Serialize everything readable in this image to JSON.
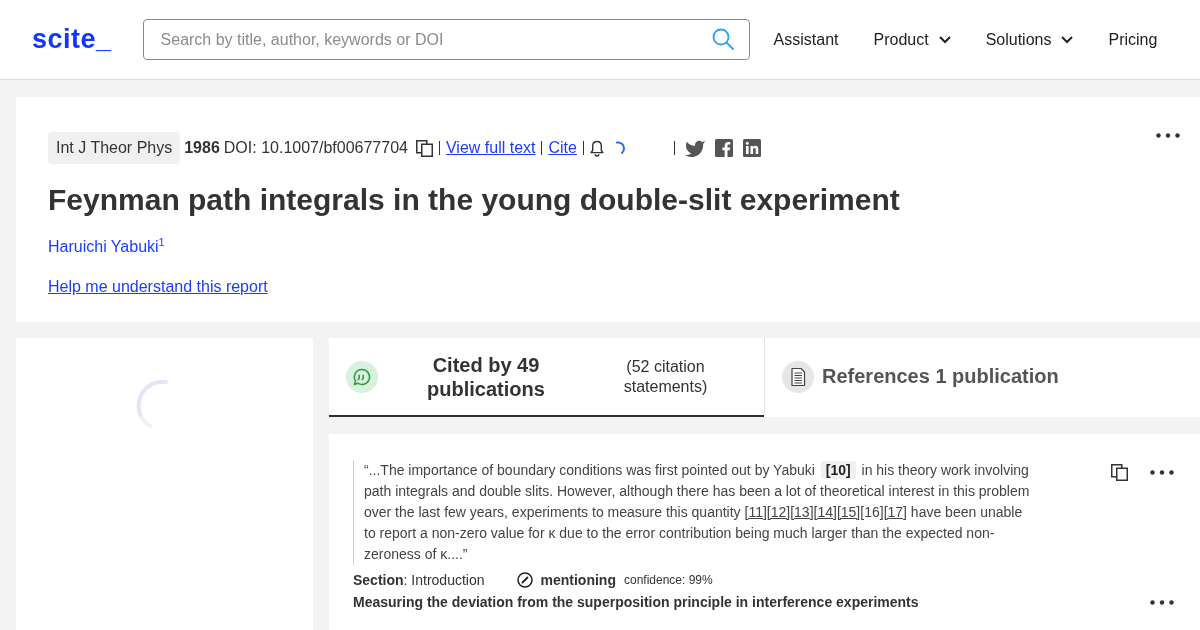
{
  "header": {
    "logo": "scite_",
    "search": {
      "placeholder": "Search by title, author, keywords or DOI"
    },
    "nav": [
      {
        "label": "Assistant",
        "dropdown": false
      },
      {
        "label": "Product",
        "dropdown": true
      },
      {
        "label": "Solutions",
        "dropdown": true
      },
      {
        "label": "Pricing",
        "dropdown": false
      }
    ]
  },
  "paper": {
    "journal": "Int J Theor Phys",
    "year": "1986",
    "doi": "DOI: 10.1007/bf00677704",
    "links": [
      "View full text",
      "Cite"
    ],
    "title": "Feynman path integrals in the young double-slit experiment",
    "authors": [
      {
        "name": "Haruichi Yabuki",
        "affiliation": "1"
      }
    ],
    "help_link": "Help me understand this report"
  },
  "tabs": [
    {
      "kind": "cited",
      "title": "Cited by 49 publications",
      "note": "(52 citation statements)",
      "selected": true
    },
    {
      "kind": "references",
      "title": "References 1 publication",
      "selected": false
    }
  ],
  "citation": {
    "quote": [
      {
        "kind": "text",
        "text": "“...The importance of boundary conditions was first pointed out by Yabuki "
      },
      {
        "kind": "marker",
        "text": "[10]"
      },
      {
        "kind": "text",
        "text": " in his theory work involving path integrals and double slits. However, although there has been a lot of theoretical interest in this problem over the last few years, experiments to measure this quantity "
      },
      {
        "kind": "link",
        "text": "[11]"
      },
      {
        "kind": "link",
        "text": "[12]"
      },
      {
        "kind": "link",
        "text": "[13]"
      },
      {
        "kind": "link",
        "text": "[14]"
      },
      {
        "kind": "link",
        "text": "[15]"
      },
      {
        "kind": "text",
        "text": "[16]"
      },
      {
        "kind": "link",
        "text": "[17]"
      },
      {
        "kind": "text",
        "text": " have been unable to report a non-zero value for κ due to the error contribution being much larger than the expected non-zeroness of κ....”"
      }
    ],
    "section": "**Section**: Introduction",
    "classification": "mentioning",
    "confidence": "confidence: 99%",
    "citing_title": "Measuring the deviation from the superposition principle in interference experiments"
  }
}
